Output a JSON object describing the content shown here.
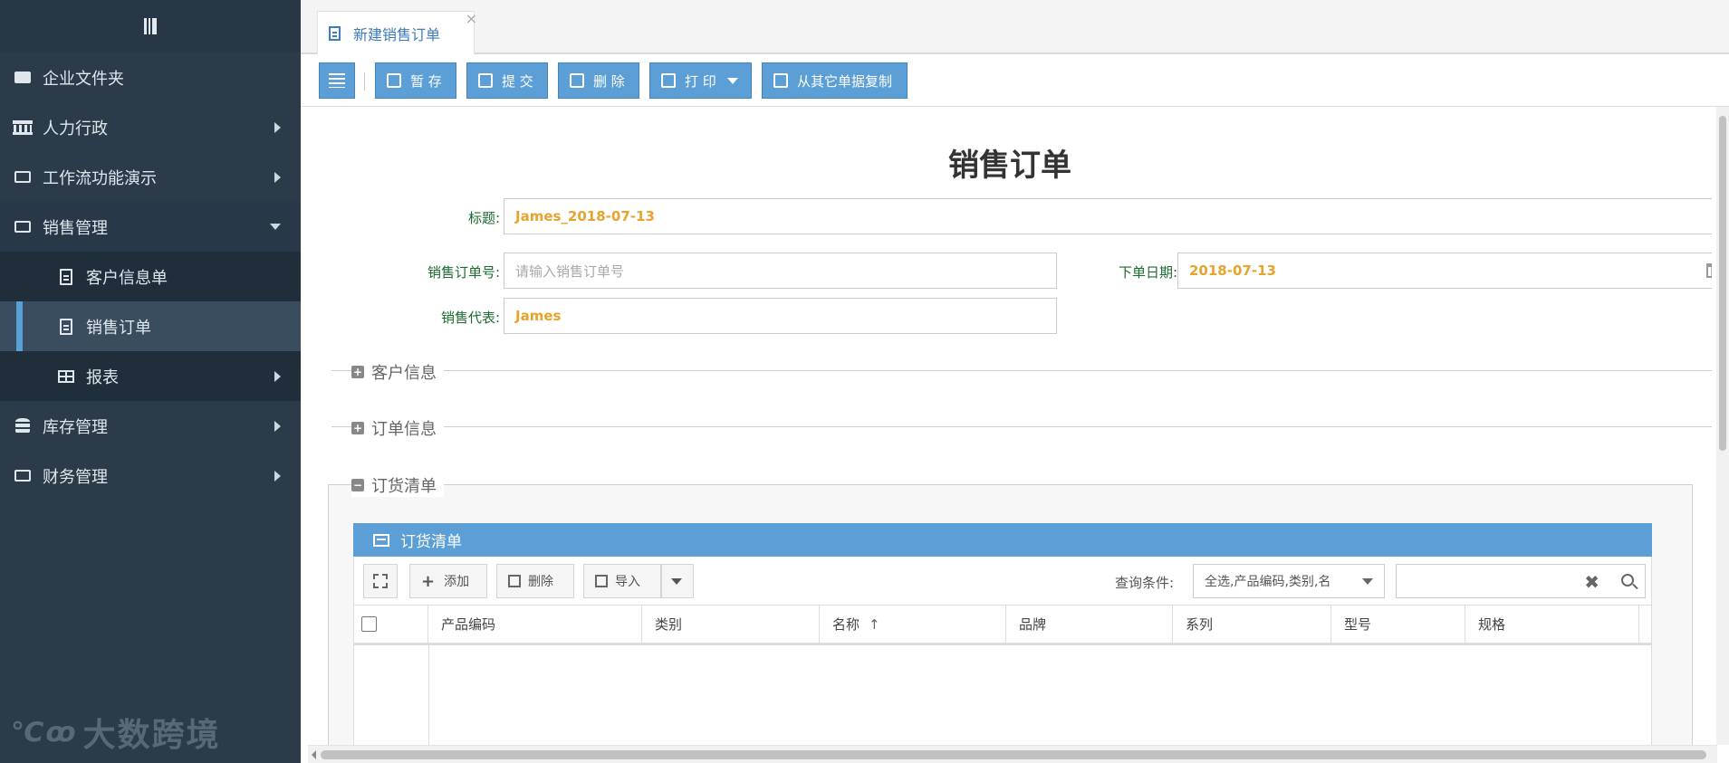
{
  "sidebar": {
    "items": [
      {
        "label": "企业文件夹",
        "icon": "folder-icon"
      },
      {
        "label": "人力行政",
        "icon": "bank-icon"
      },
      {
        "label": "工作流功能演示",
        "icon": "folder-open-icon"
      },
      {
        "label": "销售管理",
        "icon": "folder-open-icon"
      },
      {
        "label": "库存管理",
        "icon": "database-icon"
      },
      {
        "label": "财务管理",
        "icon": "folder-open-icon"
      }
    ],
    "sub_items": [
      {
        "label": "客户信息单",
        "icon": "document-icon"
      },
      {
        "label": "销售订单",
        "icon": "document-icon"
      },
      {
        "label": "报表",
        "icon": "table-icon"
      }
    ],
    "brand": "大数跨境",
    "brand_logo": "℃ꝏ"
  },
  "tabs": [
    {
      "label": "新建销售订单",
      "close": "×"
    }
  ],
  "toolbar": {
    "save": "暂 存",
    "submit": "提 交",
    "delete": "删 除",
    "print": "打 印",
    "copy": "从其它单据复制"
  },
  "form": {
    "title": "销售订单",
    "title_label": "标题:",
    "title_value": "James_2018-07-13",
    "order_no_label": "销售订单号:",
    "order_no_placeholder": "请输入销售订单号",
    "date_label": "下单日期:",
    "date_value": "2018-07-13",
    "rep_label": "销售代表:",
    "rep_value": "James"
  },
  "sections": {
    "customer": "客户信息",
    "order": "订单信息",
    "items": "订货清单"
  },
  "grid": {
    "panel_title": "订货清单",
    "add": "添加",
    "delete": "删除",
    "import": "导入",
    "query_label": "查询条件:",
    "query_value": "全选,产品编码,类别,名",
    "columns": [
      "产品编码",
      "类别",
      "名称",
      "品牌",
      "系列",
      "型号",
      "规格"
    ],
    "sort_indicator": "↑"
  },
  "colors": {
    "sidebar_bg": "#2c3b4a",
    "accent": "#5c9fd6",
    "label_green": "#1b6b2f",
    "value_orange": "#e8a32c"
  }
}
